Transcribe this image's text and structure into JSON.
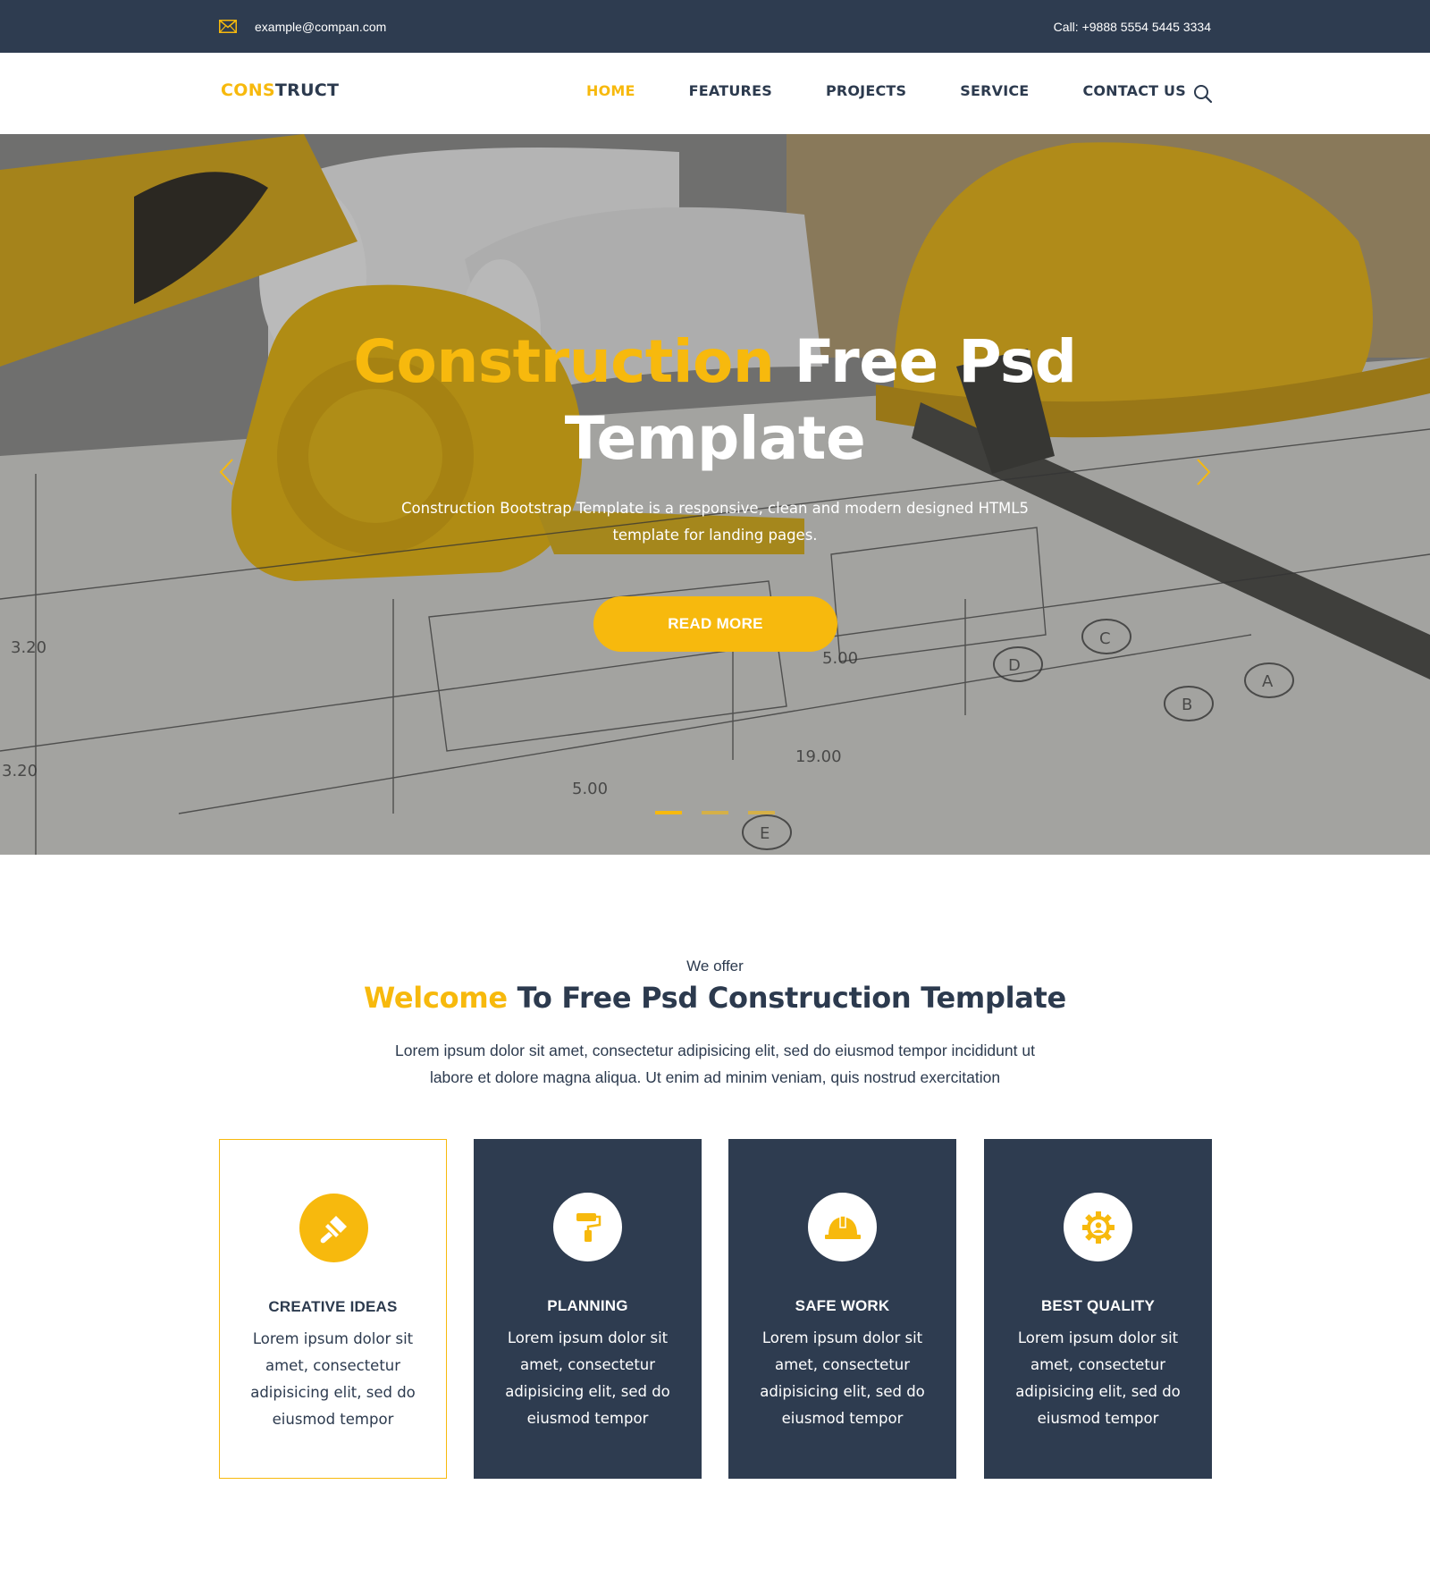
{
  "topbar": {
    "email": "example@compan.com",
    "phone": "Call: +9888 5554 5445 3334"
  },
  "brand": {
    "part1": "CONS",
    "part2": "TRUCT"
  },
  "nav": {
    "items": [
      {
        "label": "HOME",
        "active": true
      },
      {
        "label": "FEATURES",
        "active": false
      },
      {
        "label": "PROJECTS",
        "active": false
      },
      {
        "label": "SERVICE",
        "active": false
      },
      {
        "label": "CONTACT US",
        "active": false
      }
    ]
  },
  "hero": {
    "title_highlight": "Construction",
    "title_rest": "Free Psd",
    "title_line2": "Template",
    "subtitle": "Construction Bootstrap Template is a responsive, clean and modern designed HTML5 template for landing pages.",
    "cta": "READ MORE",
    "slides": 3,
    "active_slide": 1
  },
  "offer": {
    "kicker": "We offer",
    "title_highlight": "Welcome",
    "title_rest": "To Free Psd Construction Template",
    "description": "Lorem ipsum dolor sit amet, consectetur adipisicing elit, sed do eiusmod tempor incididunt ut labore et dolore magna aliqua. Ut enim ad minim veniam, quis nostrud exercitation",
    "cards": [
      {
        "title": "CREATIVE IDEAS",
        "text": "Lorem ipsum dolor sit amet, consectetur adipisicing elit, sed do eiusmod tempor",
        "icon": "brush-icon"
      },
      {
        "title": "PLANNING",
        "text": "Lorem ipsum dolor sit amet, consectetur adipisicing elit, sed do eiusmod tempor",
        "icon": "paint-roller-icon"
      },
      {
        "title": "SAFE WORK",
        "text": "Lorem ipsum dolor sit amet, consectetur adipisicing elit, sed do eiusmod tempor",
        "icon": "hard-hat-icon"
      },
      {
        "title": "BEST QUALITY",
        "text": "Lorem ipsum dolor sit amet, consectetur adipisicing elit, sed do eiusmod tempor",
        "icon": "gear-user-icon"
      }
    ]
  },
  "colors": {
    "accent": "#f7b90d",
    "navy": "#2e3c50",
    "text": "#2c3a4e"
  }
}
